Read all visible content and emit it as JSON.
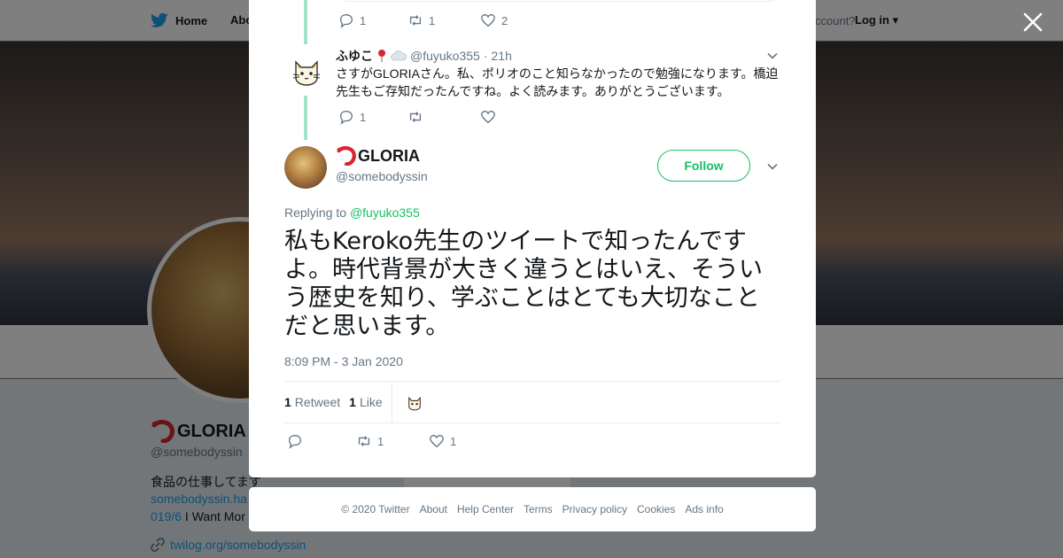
{
  "nav": {
    "home_label": "Home",
    "about_label": "Abo",
    "account_prompt": "ccount?",
    "login_label": "Log in"
  },
  "profile": {
    "name": "GLORIA",
    "handle": "@somebodyssin",
    "bio": "食品の仕事してます",
    "link": "somebodyssin.ha",
    "line3_prefix": "019/6",
    "line3_text": " I Want Mor",
    "website": "twilog.org/somebodyssin",
    "side_text": "Ads info"
  },
  "thread": {
    "prev_actions": {
      "replies": "1",
      "retweets": "1",
      "likes": "2"
    },
    "reply": {
      "name": "ふゆこ",
      "handle": "@fuyuko355",
      "separator": "·",
      "time": "21h",
      "text": "さすがGLORIAさん。私、ポリオのこと知らなかったので勉強になります。橋迫先生もご存知だったんですね。よく読みます。ありがとうございます。",
      "actions": {
        "replies": "1",
        "retweets": "",
        "likes": ""
      }
    },
    "main": {
      "name": "GLORIA",
      "handle": "@somebodyssin",
      "follow_label": "Follow",
      "replying_prefix": "Replying to ",
      "replying_to": "@fuyuko355",
      "text": "私もKeroko先生のツイートで知ったんですよ。時代背景が大きく違うとはいえ、そういう歴史を知り、学ぶことはとても大切なことだと思います。",
      "timestamp": "8:09 PM - 3 Jan 2020",
      "retweet_count": "1",
      "retweet_label": "Retweet",
      "like_count": "1",
      "like_label": "Like",
      "actions": {
        "replies": "",
        "retweets": "1",
        "likes": "1"
      }
    }
  },
  "footer": {
    "items": [
      "© 2020 Twitter",
      "About",
      "Help Center",
      "Terms",
      "Privacy policy",
      "Cookies",
      "Ads info"
    ]
  },
  "colors": {
    "accent_green": "#17bf63",
    "thread_line": "#a5e3c9",
    "text_primary": "#14171a",
    "text_secondary": "#657786",
    "twitter_blue": "#1da1f2"
  },
  "icons": [
    "twitter-bird-icon",
    "close-icon",
    "reply-icon",
    "retweet-icon",
    "like-icon",
    "chevron-down-icon",
    "pin-icon",
    "cloud-icon",
    "shrimp-icon",
    "cat-avatar-icon",
    "link-icon"
  ]
}
